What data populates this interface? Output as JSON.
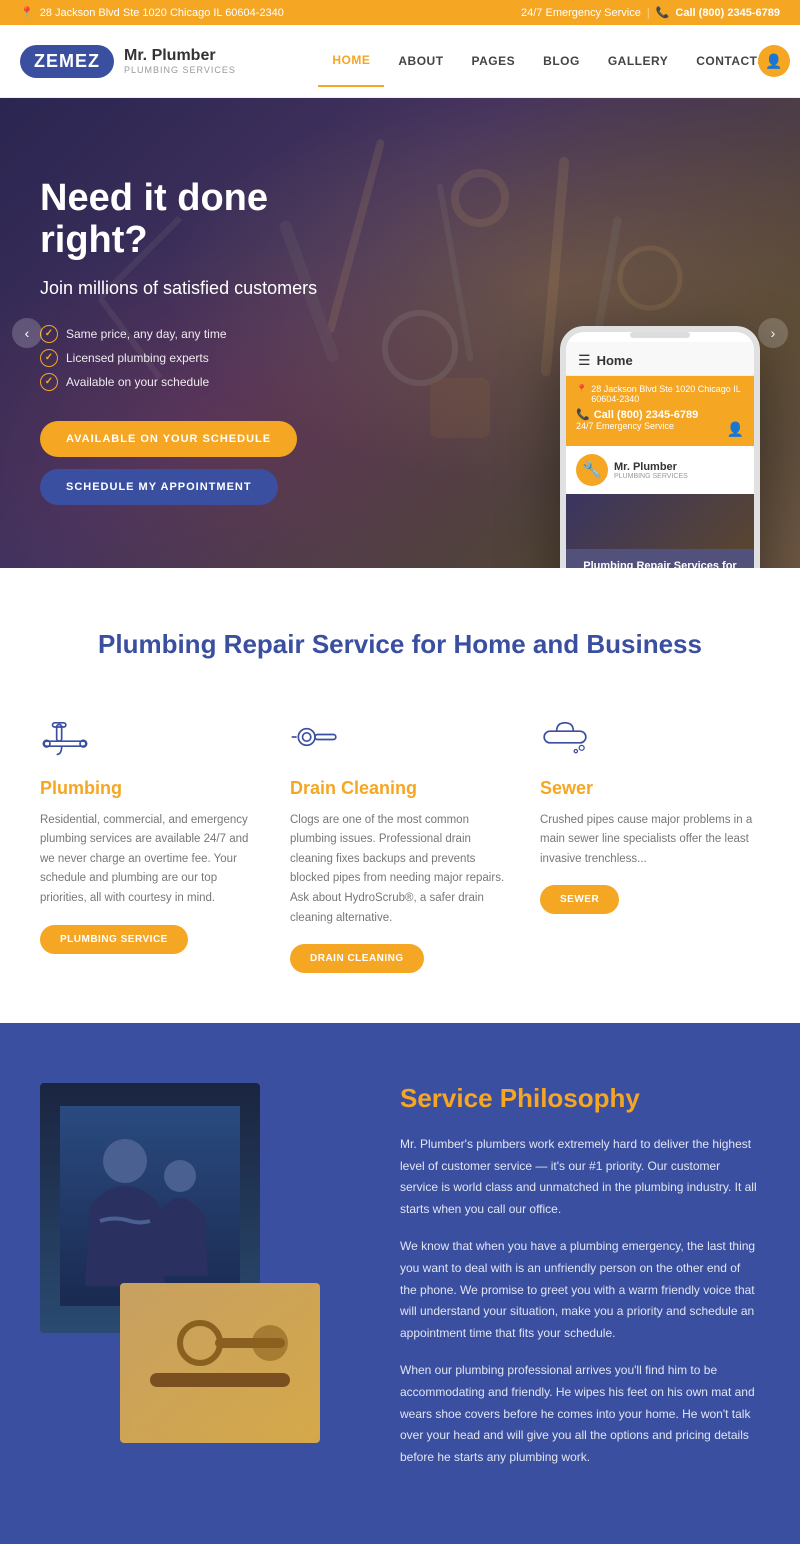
{
  "topbar": {
    "address": "28 Jackson Blvd Ste 1020 Chicago IL 60604-2340",
    "emergency": "24/7 Emergency Service",
    "phone": "Call (800) 2345-6789",
    "address_icon": "📍",
    "phone_icon": "📞"
  },
  "header": {
    "logo": "ZEMEZ",
    "brand_name": "Mr. Plumber",
    "brand_sub": "PLUMBING SERVICES",
    "nav": [
      {
        "label": "HOME",
        "active": true
      },
      {
        "label": "ABOUT",
        "active": false
      },
      {
        "label": "PAGES",
        "active": false
      },
      {
        "label": "BLOG",
        "active": false
      },
      {
        "label": "GALLERY",
        "active": false
      },
      {
        "label": "CONTACTS",
        "active": false
      }
    ]
  },
  "hero": {
    "headline": "Need it done right?",
    "subtitle": "Join millions of satisfied customers",
    "checklist": [
      "Same price, any day, any time",
      "Licensed plumbing experts",
      "Available on your schedule"
    ],
    "cta_primary": "AVAILABLE ON YOUR SCHEDULE",
    "cta_secondary": "SCHEDULE MY APPOINTMENT"
  },
  "phone_mockup": {
    "home_label": "Home",
    "address": "28 Jackson Blvd Ste 1020 Chicago IL 60604-2340",
    "phone": "Call (800) 2345-6789",
    "emergency": "24/7 Emergency Service",
    "brand": "Mr. Plumber",
    "brand_sub": "PLUMBING SERVICES",
    "service_text": "Plumbing Repair Services for Home and Business"
  },
  "services": {
    "title": "Plumbing Repair Service for Home and Business",
    "items": [
      {
        "name": "Plumbing",
        "description": "Residential, commercial, and emergency plumbing services are available 24/7 and we never charge an overtime fee. Your schedule and plumbing are our top priorities, all with courtesy in mind.",
        "button": "PLUMBING SERVICE"
      },
      {
        "name": "Drain Cleaning",
        "description": "Clogs are one of the most common plumbing issues. Professional drain cleaning fixes backups and prevents blocked pipes from needing major repairs. Ask about HydroScrub®, a safer drain cleaning alternative.",
        "button": "DRAIN CLEANING"
      },
      {
        "name": "Sew...",
        "description": "Crushed... major pl... in a main... specialize... the least... trenchle...",
        "button": "SEW..."
      }
    ]
  },
  "philosophy": {
    "title": "Service Philosophy",
    "paragraphs": [
      "Mr. Plumber's plumbers work extremely hard to deliver the highest level of customer service — it's our #1 priority. Our customer service is world class and unmatched in the plumbing industry. It all starts when you call our office.",
      "We know that when you have a plumbing emergency, the last thing you want to deal with is an unfriendly person on the other end of the phone. We promise to greet you with a warm friendly voice that will understand your situation, make you a priority and schedule an appointment time that fits your schedule.",
      "When our plumbing professional arrives you'll find him to be accommodating and friendly. He wipes his feet on his own mat and wears shoe covers before he comes into your home. He won't talk over your head and will give you all the options and pricing details before he starts any plumbing work."
    ]
  },
  "colors": {
    "orange": "#f5a623",
    "blue_dark": "#3a4fa0",
    "blue_nav": "#3a4fa0",
    "text_dark": "#333333",
    "text_muted": "#777777"
  }
}
